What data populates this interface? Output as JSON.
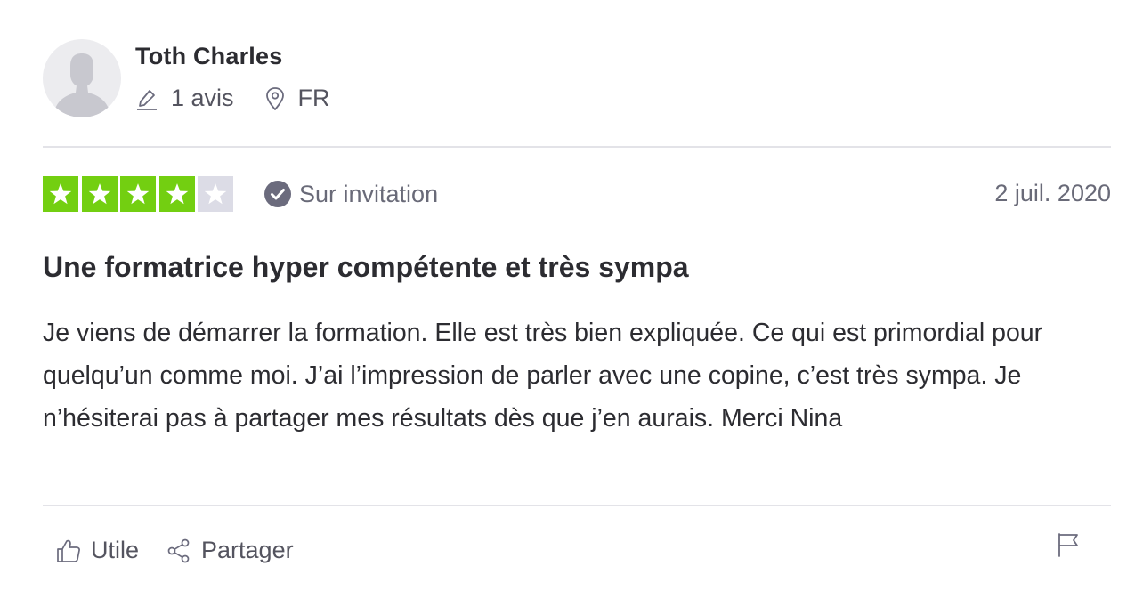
{
  "consumer": {
    "name": "Toth Charles",
    "reviews_count": "1 avis",
    "country": "FR"
  },
  "review": {
    "rating": 4,
    "max_rating": 5,
    "verification_label": "Sur invitation",
    "date": "2 juil. 2020",
    "title": "Une formatrice hyper compétente et très sympa",
    "body": "Je viens de démarrer la formation. Elle est très bien expliquée. Ce qui est primordial pour quelqu’un comme moi. J’ai l’impression de parler avec une copine, c’est très sympa. Je n’hésiterai pas à partager mes résultats dès que j’en aurais. Merci Nina"
  },
  "actions": {
    "useful_label": "Utile",
    "share_label": "Partager"
  },
  "colors": {
    "star_filled": "#73cf11",
    "star_empty": "#dcdce6",
    "verified_badge": "#6b6b7d",
    "text_primary": "#2c2c31",
    "text_secondary": "#696a78"
  },
  "icons": {
    "avatar": "person-silhouette-icon",
    "reviews": "pencil-icon",
    "location": "location-pin-icon",
    "verified": "check-circle-icon",
    "useful": "thumbs-up-icon",
    "share": "share-icon",
    "report": "flag-icon"
  }
}
